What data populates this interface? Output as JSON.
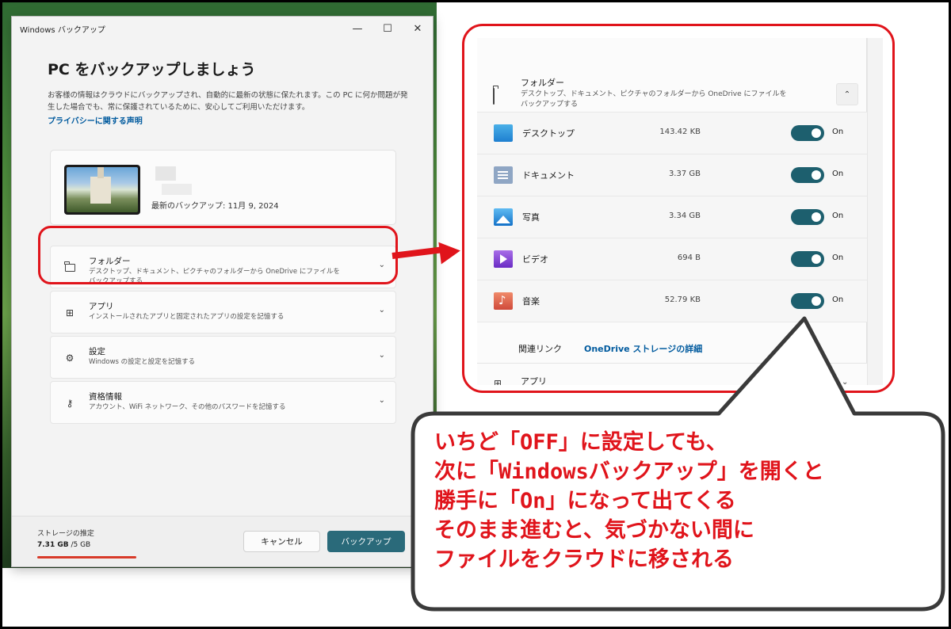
{
  "window": {
    "title": "Windows バックアップ",
    "minimize_glyph": "—",
    "maximize_glyph": "☐",
    "close_glyph": "✕"
  },
  "main": {
    "heading": "PC をバックアップしましょう",
    "description": "お客様の情報はクラウドにバックアップされ、自動的に最新の状態に保たれます。この PC に何か問題が発生した場合でも、常に保護されているために、安心してご利用いただけます。",
    "privacy_link": "プライバシーに関する声明",
    "last_backup": "最新のバックアップ: 11月 9, 2024",
    "sections": [
      {
        "title": "フォルダー",
        "subtitle": "デスクトップ、ドキュメント、ピクチャのフォルダーから OneDrive にファイルをバックアップする",
        "icon": "folder-icon"
      },
      {
        "title": "アプリ",
        "subtitle": "インストールされたアプリと固定されたアプリの設定を記憶する",
        "icon": "apps-icon"
      },
      {
        "title": "設定",
        "subtitle": "Windows の設定と設定を記憶する",
        "icon": "gear-icon"
      },
      {
        "title": "資格情報",
        "subtitle": "アカウント、WiFi ネットワーク、その他のパスワードを記憶する",
        "icon": "key-icon"
      }
    ]
  },
  "footer": {
    "storage_label": "ストレージの推定",
    "storage_used": "7.31 GB",
    "storage_total": "/5 GB",
    "cancel_label": "キャンセル",
    "backup_label": "バックアップ"
  },
  "zoom": {
    "folder_title": "フォルダー",
    "folder_subtitle": "デスクトップ、ドキュメント、ピクチャのフォルダーから OneDrive にファイルをバックアップする",
    "items": [
      {
        "name": "デスクトップ",
        "size": "143.42 KB",
        "state": "On",
        "icon": "desktop-folder-icon"
      },
      {
        "name": "ドキュメント",
        "size": "3.37 GB",
        "state": "On",
        "icon": "documents-folder-icon"
      },
      {
        "name": "写真",
        "size": "3.34 GB",
        "state": "On",
        "icon": "pictures-folder-icon"
      },
      {
        "name": "ビデオ",
        "size": "694 B",
        "state": "On",
        "icon": "videos-folder-icon"
      },
      {
        "name": "音楽",
        "size": "52.79 KB",
        "state": "On",
        "icon": "music-folder-icon"
      }
    ],
    "related_label": "関連リンク",
    "related_link": "OneDrive ストレージの詳細",
    "apps_title": "アプリ"
  },
  "annotation": {
    "lines": [
      "いちど「OFF」に設定しても、",
      "次に「Windowsバックアップ」を開くと",
      "勝手に「On」になって出てくる",
      "そのまま進むと、気づかない間に",
      "ファイルをクラウドに移される"
    ],
    "color": "#e0141b"
  }
}
